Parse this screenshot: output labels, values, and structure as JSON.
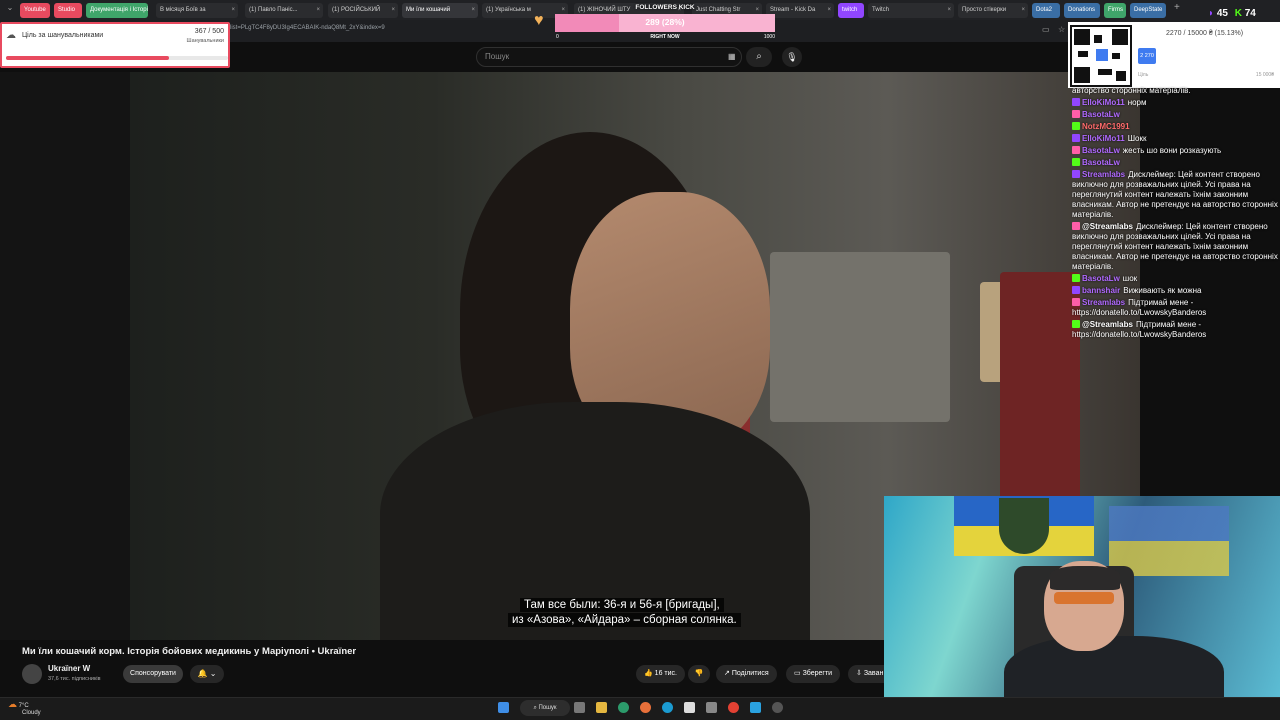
{
  "tabs": [
    {
      "label": "Youtube",
      "kind": "pill",
      "color": "#e84a5f"
    },
    {
      "label": "Studio",
      "kind": "pill",
      "color": "#e84a5f"
    },
    {
      "label": "Документація і Історія",
      "kind": "pill",
      "color": "#3fa56a"
    },
    {
      "label": "В місяця Боїв за",
      "kind": "tab"
    },
    {
      "label": "(1) Павло Паніс...",
      "kind": "tab"
    },
    {
      "label": "(1) РОСІЙСЬКИЙ",
      "kind": "tab"
    },
    {
      "label": "Ми їли кошачий",
      "kind": "active"
    },
    {
      "label": "(1) Українська м",
      "kind": "tab"
    },
    {
      "label": "(1) ЖІНОЧИЙ ШТУ",
      "kind": "tab"
    },
    {
      "label": "Just Chatting Str",
      "kind": "tab"
    },
    {
      "label": "Stream - Kick Da",
      "kind": "tab"
    },
    {
      "label": "twitch",
      "kind": "pill",
      "color": "#9146ff"
    },
    {
      "label": "Twitch",
      "kind": "tab"
    },
    {
      "label": "Просто стікерки",
      "kind": "tab"
    },
    {
      "label": "Dota2",
      "kind": "pill",
      "color": "#3a6ea5"
    },
    {
      "label": "Donations",
      "kind": "pill",
      "color": "#3a6ea5"
    },
    {
      "label": "Firms",
      "kind": "pill",
      "color": "#3fa56a"
    },
    {
      "label": "DeepState",
      "kind": "pill",
      "color": "#3a6ea5"
    }
  ],
  "address": {
    "url": "list=PLgTC4F8yDU3Ig4ECABAIK-ndaQ8Mt_2xY&index=9"
  },
  "youtube": {
    "search_placeholder": "Пошук",
    "video_title": "Ми їли кошачий корм. Історія бойових медикинь у Маріуполі • Ukraïner",
    "channel_name": "Ukraïner W",
    "channel_subs": "37,6 тис. підписників",
    "sponsor_label": "Спонсорувати",
    "likes": "16 тис.",
    "share_label": "Поділитися",
    "save_label": "Зберегти",
    "more_label": "Заван",
    "subtitle_line1": "Там все были: 36-я и 56-я [бригады],",
    "subtitle_line2": "из «Азова», «Айдара» – сборная солянка."
  },
  "fan_goal": {
    "title": "Ціль за шанувальниками",
    "count": "367 / 500",
    "subtitle": "Шанувальники",
    "progress": 0.734
  },
  "followers_goal": {
    "label": "FOLLOWERS KICK",
    "value_text": "289 (28%)",
    "min": "0",
    "center": "RIGHT NOW",
    "max": "1000",
    "progress": 0.289
  },
  "donation_goal": {
    "amount": "2270 / 15000 ₴ (15.13%)",
    "badge": "2 270",
    "low_label": "Ціль",
    "high_label": "15 000₴"
  },
  "counters": {
    "twitch_viewers": "45",
    "kick_viewers": "74"
  },
  "chat": [
    {
      "user": "",
      "text": "авторство сторонніх матеріалів.",
      "color": "#ffffff"
    },
    {
      "user": "ElloKiMo11",
      "text": "норм",
      "color": "#b069ff"
    },
    {
      "user": "BasotaLw",
      "text": "",
      "color": "#b069ff"
    },
    {
      "user": "NotzMC1991",
      "text": "",
      "color": "#ff6b6b"
    },
    {
      "user": "ElloKiMo11",
      "text": "Шокк",
      "color": "#b069ff"
    },
    {
      "user": "BasotaLw",
      "text": "жесть шо вони розказують",
      "color": "#b069ff"
    },
    {
      "user": "BasotaLw",
      "text": "",
      "color": "#b069ff"
    },
    {
      "user": "Streamlabs",
      "text": "Дисклеймер: Цей контент створено виключно для розважальних цілей. Усі права на переглянутий контент належать їхнім законним власникам. Автор не претендує на авторство сторонніх матеріалів.",
      "color": "#b069ff"
    },
    {
      "user": "@Streamlabs",
      "text": "Дисклеймер: Цей контент створено виключно для розважальних цілей. Усі права на переглянутий контент належать їхнім законним власникам. Автор не претендує на авторство сторонніх матеріалів.",
      "color": "#ffffff"
    },
    {
      "user": "BasotaLw",
      "text": "шок",
      "color": "#b069ff"
    },
    {
      "user": "bannshair",
      "text": "Виживають як можна",
      "color": "#b069ff"
    },
    {
      "user": "Streamlabs",
      "text": "Підтримай мене - https://donatello.to/LwowskyBanderos",
      "color": "#b069ff"
    },
    {
      "user": "@Streamlabs",
      "text": "Підтримай мене - https://donatello.to/LwowskyBanderos",
      "color": "#ffffff"
    }
  ],
  "taskbar": {
    "temp": "7°C",
    "weather": "Cloudy",
    "search_label": "Пошук"
  }
}
